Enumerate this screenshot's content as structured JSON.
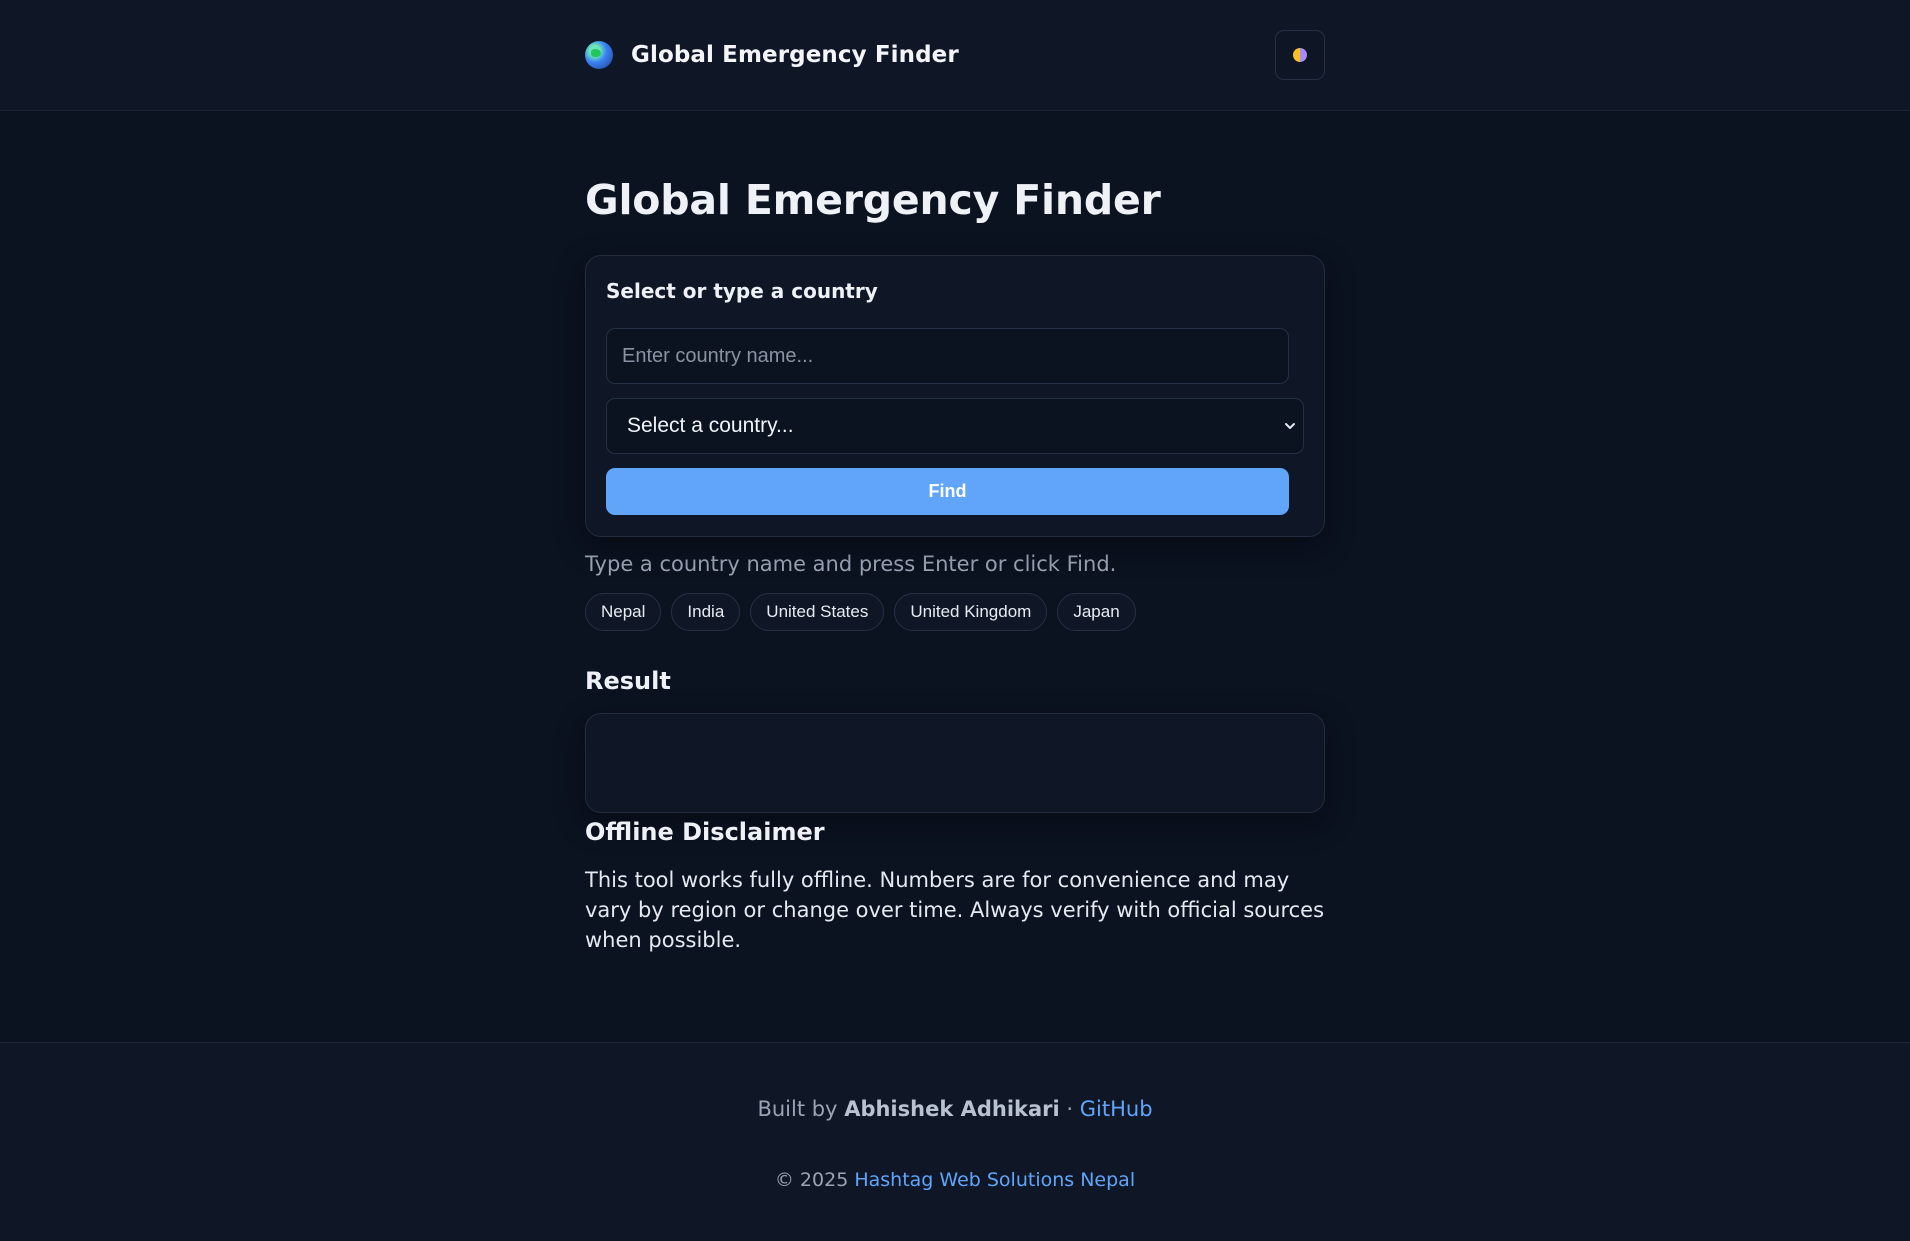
{
  "header": {
    "brand_icon": "globe-icon",
    "brand_title": "Global Emergency Finder",
    "theme_toggle_icon": "half-circle-theme-icon"
  },
  "main": {
    "page_title": "Global Emergency Finder",
    "card": {
      "label": "Select or type a country",
      "input_placeholder": "Enter country name...",
      "input_value": "",
      "select_value": "Select a country...",
      "find_label": "Find"
    },
    "hint": "Type a country name and press Enter or click Find.",
    "quick_countries": [
      "Nepal",
      "India",
      "United States",
      "United Kingdom",
      "Japan"
    ],
    "result_heading": "Result",
    "result_content": "",
    "disclaimer_heading": "Offline Disclaimer",
    "disclaimer_text": "This tool works fully offline. Numbers are for convenience and may vary by region or change over time. Always verify with official sources when possible."
  },
  "footer": {
    "built_by_prefix": "Built by",
    "author": "Abhishek Adhikari",
    "separator": "·",
    "github_label": "GitHub",
    "copyright": "© 2025",
    "company_link": "Hashtag Web Solutions Nepal"
  },
  "colors": {
    "background": "#0b1220",
    "surface": "#0f1726",
    "accent": "#60a5fa",
    "text": "#e5e9f0",
    "muted": "#9aa4b5"
  }
}
